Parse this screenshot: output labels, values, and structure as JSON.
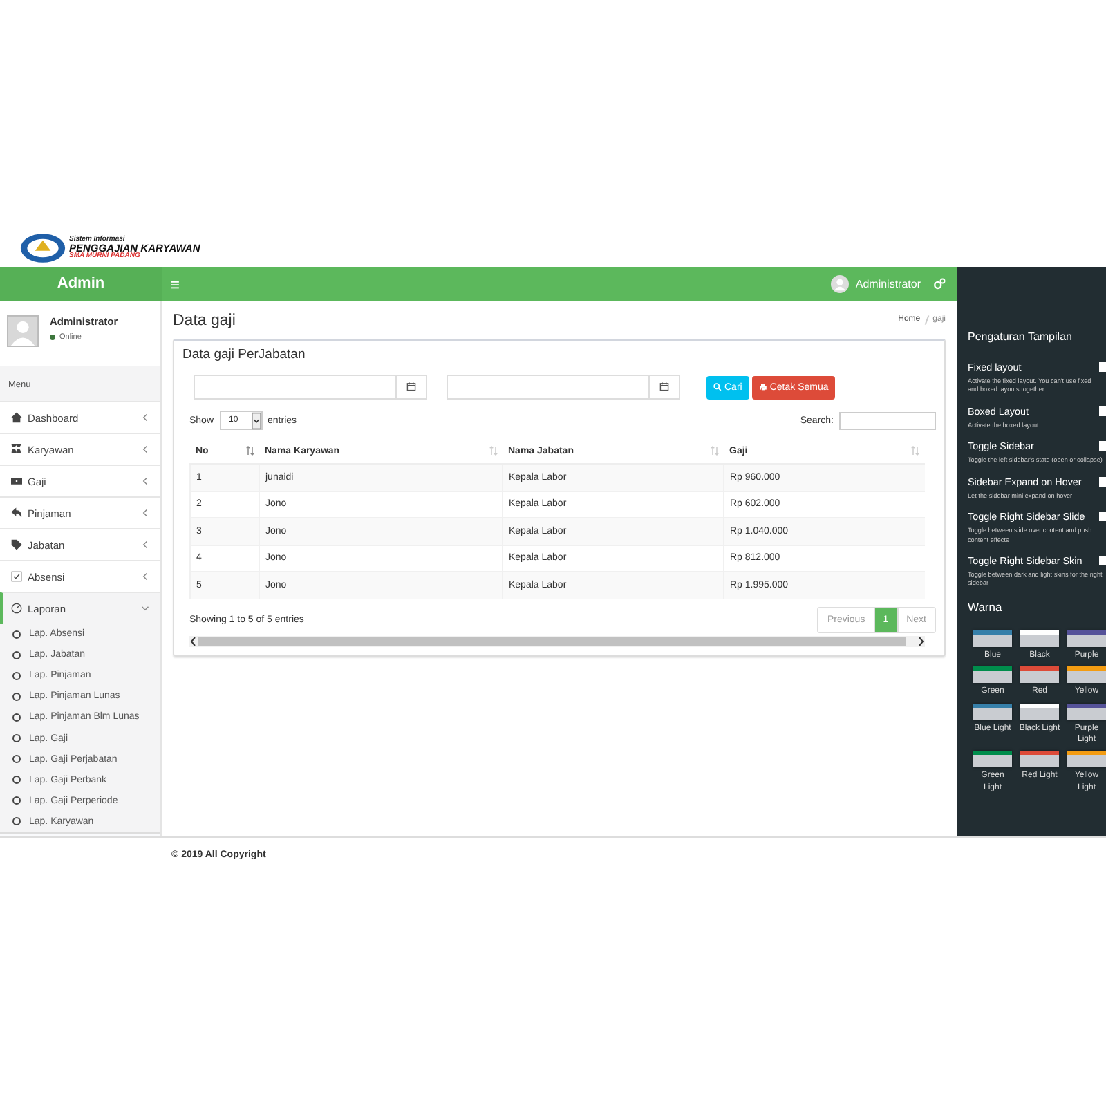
{
  "logo": {
    "line_1": "Sistem Informasi",
    "line_2": "PENGGAJIAN KARYAWAN",
    "line_3": "SMA MURNI PADANG"
  },
  "header": {
    "brand": "Admin",
    "menu_icon": "≡",
    "user": "Administrator"
  },
  "sidebar": {
    "user": {
      "name": "Administrator",
      "status": "Online"
    },
    "section": "Menu",
    "items": [
      {
        "label": "Dashboard",
        "expanded": false,
        "selected": false
      },
      {
        "label": "Karyawan",
        "expanded": false,
        "selected": false
      },
      {
        "label": "Gaji",
        "expanded": false,
        "selected": false
      },
      {
        "label": "Pinjaman",
        "expanded": false,
        "selected": false
      },
      {
        "label": "Jabatan",
        "expanded": false,
        "selected": false
      },
      {
        "label": "Absensi",
        "expanded": false,
        "selected": false
      },
      {
        "label": "Laporan",
        "expanded": true,
        "selected": true,
        "children": [
          {
            "label": "Lap. Absensi"
          },
          {
            "label": "Lap. Jabatan"
          },
          {
            "label": "Lap. Pinjaman"
          },
          {
            "label": "Lap. Pinjaman Lunas"
          },
          {
            "label": "Lap. Pinjaman Blm Lunas"
          },
          {
            "label": "Lap. Gaji"
          },
          {
            "label": "Lap. Gaji Perjabatan"
          },
          {
            "label": "Lap. Gaji Perbank"
          },
          {
            "label": "Lap. Gaji Perperiode"
          },
          {
            "label": "Lap. Karyawan"
          }
        ]
      }
    ]
  },
  "page": {
    "title": "Data gaji",
    "breadcrumb": [
      "Home",
      "gaji"
    ]
  },
  "box": {
    "title": "Data gaji PerJabatan",
    "search_button": "Cari",
    "print_button": "Cetak Semua",
    "show_label": "Show",
    "entries_value": "10",
    "entries_label": "entries",
    "search_label": "Search:",
    "columns": [
      "No",
      "Nama Karyawan",
      "Nama Jabatan",
      "Gaji"
    ],
    "rows": [
      [
        "1",
        "junaidi",
        "Kepala Labor",
        "Rp 960.000"
      ],
      [
        "2",
        "Jono",
        "Kepala Labor",
        "Rp 602.000"
      ],
      [
        "3",
        "Jono",
        "Kepala Labor",
        "Rp 1.040.000"
      ],
      [
        "4",
        "Jono",
        "Kepala Labor",
        "Rp 812.000"
      ],
      [
        "5",
        "Jono",
        "Kepala Labor",
        "Rp 1.995.000"
      ]
    ],
    "info": "Showing 1 to 5 of 5 entries",
    "pagination": [
      {
        "label": "Previous",
        "selected": false,
        "disabled": true
      },
      {
        "label": "1",
        "selected": true,
        "disabled": false
      },
      {
        "label": "Next",
        "selected": false,
        "disabled": true
      }
    ]
  },
  "footer": "© 2019 All Copyright",
  "control_panel": {
    "title": "Pengaturan Tampilan",
    "options": [
      {
        "label": "Fixed layout",
        "desc": "Activate the fixed layout. You can't use fixed and boxed layouts together",
        "checked": false
      },
      {
        "label": "Boxed Layout",
        "desc": "Activate the boxed layout",
        "checked": false
      },
      {
        "label": "Toggle Sidebar",
        "desc": "Toggle the left sidebar's state (open or collapse)",
        "checked": false
      },
      {
        "label": "Sidebar Expand on Hover",
        "desc": "Let the sidebar mini expand on hover",
        "checked": false
      },
      {
        "label": "Toggle Right Sidebar Slide",
        "desc": "Toggle between slide over content and push content effects",
        "checked": false
      },
      {
        "label": "Toggle Right Sidebar Skin",
        "desc": "Toggle between dark and light skins for the right sidebar",
        "checked": false
      }
    ],
    "skins_title": "Warna",
    "skins": [
      {
        "label": "Blue",
        "color": "#367fa9"
      },
      {
        "label": "Black",
        "color": "#fefefe"
      },
      {
        "label": "Purple",
        "color": "#555299"
      },
      {
        "label": "Green",
        "color": "#008d4c"
      },
      {
        "label": "Red",
        "color": "#dd4b39"
      },
      {
        "label": "Yellow",
        "color": "#f39c12"
      },
      {
        "label": "Blue Light",
        "color": "#367fa9"
      },
      {
        "label": "Black Light",
        "color": "#fefefe"
      },
      {
        "label": "Purple Light",
        "color": "#555299"
      },
      {
        "label": "Green Light",
        "color": "#008d4c"
      },
      {
        "label": "Red Light",
        "color": "#dd4b39"
      },
      {
        "label": "Yellow Light",
        "color": "#f39c12"
      }
    ]
  }
}
